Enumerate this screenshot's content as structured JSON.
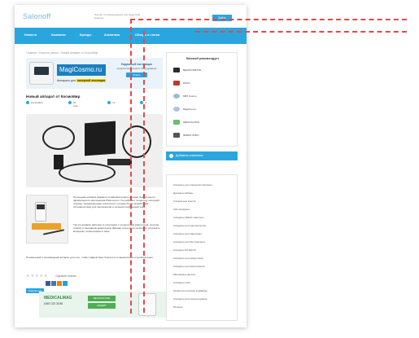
{
  "header": {
    "logo": "Salonoff",
    "tagline": "Портал об оборудовании для индустрии красоты",
    "button_label": "Войти"
  },
  "nav": {
    "items": [
      "Новости",
      "Компании",
      "Бренды",
      "Аналитика",
      "Обзоры и статьи"
    ]
  },
  "breadcrumbs": "Главная  ›  Новости рынка  ›  Новый аппарат от КосмоМир",
  "banner": {
    "site": "MagiCosmo.ru",
    "subtitle_prefix": "Аппараты для ",
    "subtitle_highlight": "лазерной эпиляции",
    "right_title": "Надежный поставщик",
    "right_sub": "профессионального оборудования",
    "right_button": "Искать"
  },
  "article": {
    "title": "Новый аппарат от КосмоМир",
    "meta_author": "КосмоМир",
    "meta_date": "04 мая",
    "meta_views": "72",
    "meta_comments": "0",
    "paragraph_1": "Последняя новинка фирмы-поставщика нового аппарат безыгольного фракционного омоложения Plasma pen. Он работает по методу холодной плазмы, инновационная технология, которая была разработана специалистами для омоложения и лечения проблемной кожи.",
    "paragraph_2": "Так же аппарат работает в сочетании с технологией микротоков, сочетая плазму и генерацию микротоков. Данная технология позволяет устранять морщины, пигментацию и акне.",
    "paragraph_3": "Плазменный и производный аппарат для того, чтобы эффективно бороться со множеством и проблем кожи.",
    "rating_label": "Оцените статью"
  },
  "share": {
    "button": "Поделиться"
  },
  "ad_bottom": {
    "brand": "MEDICALMAG",
    "phone": "8 800 222 30 88",
    "badge_1": "БЕСПЛАТНОЕ",
    "badge_2": "КРЕДИТ"
  },
  "sidebar": {
    "title": "Salonoff рекомендует",
    "partners": [
      "ВДАКОСМЕТИК",
      "ROKO",
      "MBT Cosmo",
      "MagiCosmo",
      "MEDICALMAG",
      "ФАБРИ ПИРС"
    ],
    "add_button": "Добавить компанию",
    "categories": [
      "Аппараты для лазерной эпиляции",
      "Душевые кабины",
      "Аппаратные кресла",
      "LPG-аппараты",
      "Аппараты SMAS-лифтинга",
      "Аппараты для криолиполиза",
      "Аппараты для кавитации",
      "Аппараты для RF-лифтинга",
      "Аппараты IPL/ELOS",
      "Аппараты для микротоков",
      "Аппараты для мезотерапии",
      "Массажные кресла",
      "Аппараты CO2",
      "Косметологические комбайны",
      "Аппараты для прессотерапии",
      "Пилинги"
    ]
  },
  "colors": {
    "accent": "#2aa6de",
    "annotation": "#e24a4a"
  }
}
